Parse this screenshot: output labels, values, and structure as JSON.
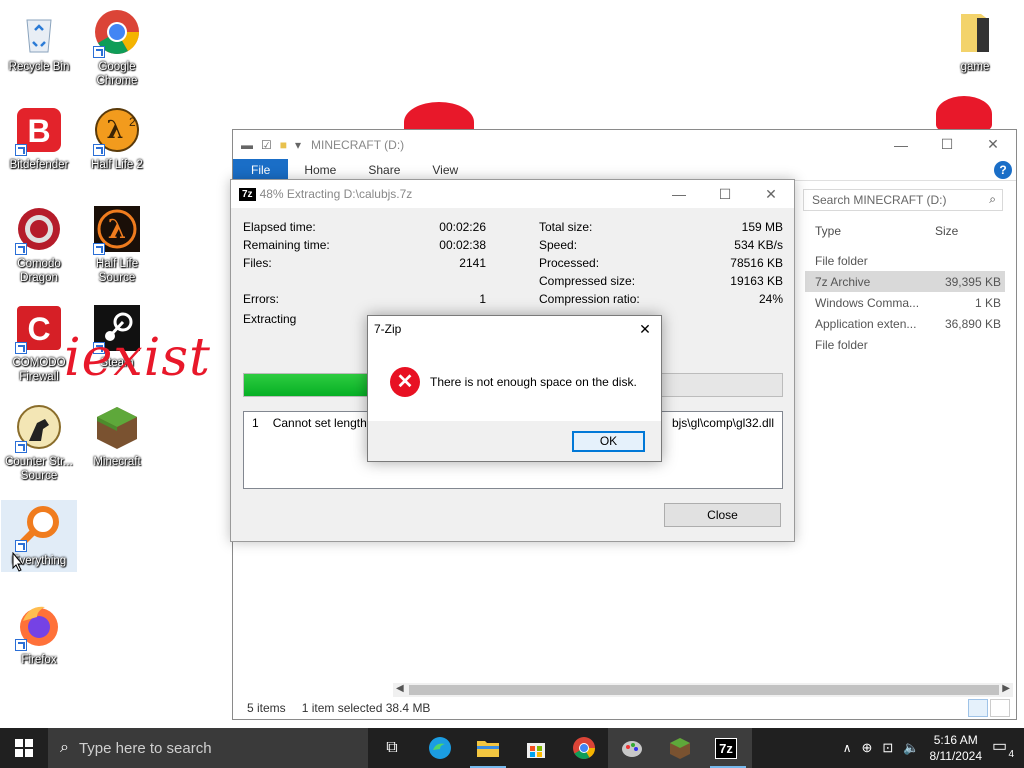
{
  "desktop": {
    "icons": [
      {
        "label": "Recycle Bin"
      },
      {
        "label": "Google Chrome"
      },
      {
        "label": "Bitdefender"
      },
      {
        "label": "Half Life 2"
      },
      {
        "label": "Comodo Dragon"
      },
      {
        "label": "Half Life Source"
      },
      {
        "label": "COMODO Firewall"
      },
      {
        "label": "Steam"
      },
      {
        "label": "Counter Str... Source"
      },
      {
        "label": "Minecraft"
      },
      {
        "label": "Everything"
      },
      {
        "label": "Firefox"
      },
      {
        "label": "game"
      }
    ],
    "watermark": "iexist"
  },
  "explorer": {
    "title": "MINECRAFT (D:)",
    "ribbon_tabs": [
      "File",
      "Home",
      "Share",
      "View"
    ],
    "search_placeholder": "Search MINECRAFT (D:)",
    "columns": [
      "Type",
      "Size"
    ],
    "rows": [
      {
        "type": "File folder",
        "size": ""
      },
      {
        "type": "7z Archive",
        "size": "39,395 KB"
      },
      {
        "type": "Windows Comma...",
        "size": "1 KB"
      },
      {
        "type": "Application exten...",
        "size": "36,890 KB"
      },
      {
        "type": "File folder",
        "size": ""
      }
    ],
    "status": {
      "items": "5 items",
      "selected": "1 item selected",
      "size": "38.4 MB"
    }
  },
  "progress_dialog": {
    "title": "48% Extracting D:\\calubjs.7z",
    "left_stats": [
      {
        "label": "Elapsed time:",
        "value": "00:02:26"
      },
      {
        "label": "Remaining time:",
        "value": "00:02:38"
      },
      {
        "label": "Files:",
        "value": "2141"
      },
      {
        "label": "",
        "value": ""
      },
      {
        "label": "Errors:",
        "value": "1"
      },
      {
        "label": "Extracting",
        "value": ""
      }
    ],
    "right_stats": [
      {
        "label": "Total size:",
        "value": "159 MB"
      },
      {
        "label": "Speed:",
        "value": "534 KB/s"
      },
      {
        "label": "Processed:",
        "value": "78516 KB"
      },
      {
        "label": "Compressed size:",
        "value": "19163 KB"
      },
      {
        "label": "Compression ratio:",
        "value": "24%"
      }
    ],
    "progress_fraction": 0.48,
    "error_line_num": "1",
    "error_line_text": "Cannot set length fo",
    "error_line_tail": "bjs\\gl\\comp\\gl32.dll",
    "close_label": "Close"
  },
  "message_box": {
    "title": "7-Zip",
    "message": "There is not enough space on the disk.",
    "ok_label": "OK"
  },
  "taskbar": {
    "search_placeholder": "Type here to search",
    "time": "5:16 AM",
    "date": "8/11/2024",
    "notification_count": "4"
  }
}
